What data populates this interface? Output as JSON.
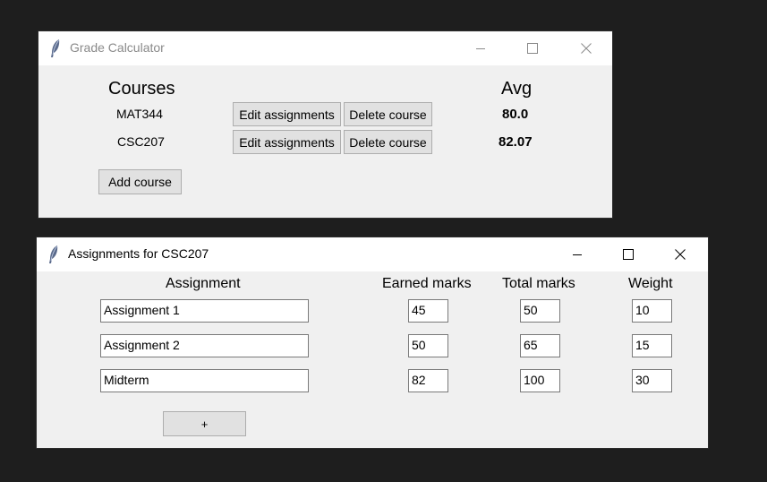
{
  "grade_window": {
    "title": "Grade Calculator",
    "courses_header": "Courses",
    "avg_header": "Avg",
    "courses": [
      {
        "name": "MAT344",
        "edit_label": "Edit assignments",
        "delete_label": "Delete course",
        "avg": "80.0"
      },
      {
        "name": "CSC207",
        "edit_label": "Edit assignments",
        "delete_label": "Delete course",
        "avg": "82.07"
      }
    ],
    "add_course_label": "Add course"
  },
  "assign_window": {
    "title": "Assignments for CSC207",
    "headers": {
      "assignment": "Assignment",
      "earned": "Earned marks",
      "total": "Total marks",
      "weight": "Weight"
    },
    "rows": [
      {
        "name": "Assignment 1",
        "earned": "45",
        "total": "50",
        "weight": "10"
      },
      {
        "name": "Assignment 2",
        "earned": "50",
        "total": "65",
        "weight": "15"
      },
      {
        "name": "Midterm",
        "earned": "82",
        "total": "100",
        "weight": "30"
      }
    ],
    "add_label": "+"
  },
  "icons": {
    "app": "feather-icon",
    "minimize": "minimize-icon",
    "maximize": "maximize-icon",
    "close": "close-icon"
  },
  "colors": {
    "desktop": "#1e1e1e",
    "window_bg": "#f0f0f0",
    "button_bg": "#e1e1e1",
    "inactive_title": "#8a8a8a"
  }
}
